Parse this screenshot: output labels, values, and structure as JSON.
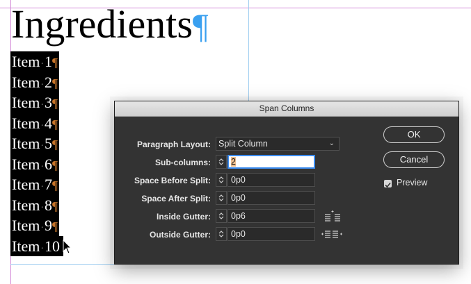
{
  "document": {
    "heading": "Ingredients",
    "heading_mark": "¶",
    "items": [
      {
        "word": "Item",
        "num": "1"
      },
      {
        "word": "Item",
        "num": "2"
      },
      {
        "word": "Item",
        "num": "3"
      },
      {
        "word": "Item",
        "num": "4"
      },
      {
        "word": "Item",
        "num": "5"
      },
      {
        "word": "Item",
        "num": "6"
      },
      {
        "word": "Item",
        "num": "7"
      },
      {
        "word": "Item",
        "num": "8"
      },
      {
        "word": "Item",
        "num": "9"
      },
      {
        "word": "Item",
        "num": "10"
      }
    ],
    "dot": "·",
    "para_mark": "¶"
  },
  "dialog": {
    "title": "Span Columns",
    "paragraph_layout_label": "Paragraph Layout:",
    "paragraph_layout_value": "Split Column",
    "sub_columns_label": "Sub-columns:",
    "sub_columns_value": "2",
    "space_before_label": "Space Before Split:",
    "space_before_value": "0p0",
    "space_after_label": "Space After Split:",
    "space_after_value": "0p0",
    "inside_gutter_label": "Inside Gutter:",
    "inside_gutter_value": "0p6",
    "outside_gutter_label": "Outside Gutter:",
    "outside_gutter_value": "0p0",
    "ok_label": "OK",
    "cancel_label": "Cancel",
    "preview_label": "Preview",
    "preview_checked": true
  },
  "colors": {
    "guide_magenta": "#d38bd8",
    "column_guide_blue": "#9ecdf0",
    "pilcrow_blue": "#3aa0f0",
    "pilcrow_orange": "#c8752a",
    "dialog_bg": "#333333",
    "focus_blue": "#3c8cf0"
  }
}
